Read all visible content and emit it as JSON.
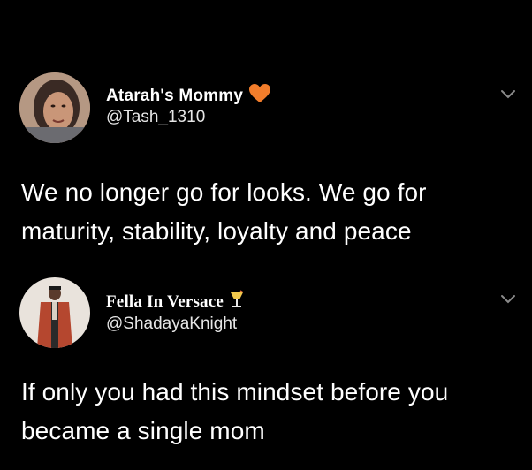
{
  "tweets": [
    {
      "display_name": "Atarah's Mommy",
      "handle": "@Tash_1310",
      "name_emoji": "heart-icon",
      "text": "We no longer go for looks. We go for maturity, stability, loyalty and peace"
    },
    {
      "display_name": "Fella In Versace",
      "handle": "@ShadayaKnight",
      "name_emoji": "tropical-drink-icon",
      "text": "If only you had this mindset before you became a single mom"
    }
  ],
  "colors": {
    "background": "#000000",
    "text": "#ffffff",
    "heart": "#f27d2b",
    "chevron": "#8b8b8b"
  }
}
